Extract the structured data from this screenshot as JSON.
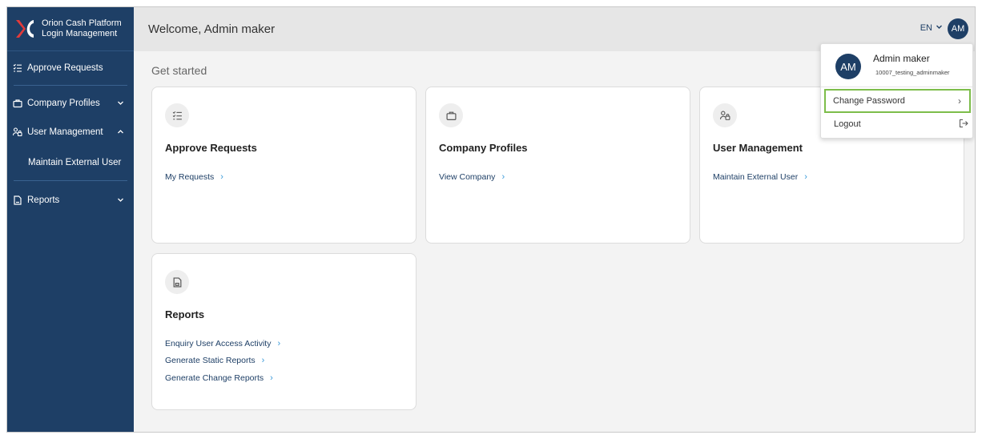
{
  "sidebar": {
    "brand_line1": "Orion Cash Platform",
    "brand_line2": "Login Management",
    "items": {
      "approve": "Approve Requests",
      "company": "Company Profiles",
      "users": "User Management",
      "maintain": "Maintain External User",
      "reports": "Reports"
    }
  },
  "header": {
    "welcome": "Welcome, Admin maker",
    "lang": "EN",
    "avatar": "AM"
  },
  "main": {
    "get_started": "Get started",
    "cards": [
      {
        "title": "Approve Requests",
        "links": [
          "My Requests"
        ]
      },
      {
        "title": "Company Profiles",
        "links": [
          "View Company"
        ]
      },
      {
        "title": "User Management",
        "links": [
          "Maintain External User"
        ]
      },
      {
        "title": "Reports",
        "links": [
          "Enquiry User Access Activity",
          "Generate Static Reports",
          "Generate Change Reports"
        ]
      }
    ]
  },
  "dropdown": {
    "avatar": "AM",
    "name": "Admin maker",
    "user_id": "10007_testing_adminmaker",
    "change_password": "Change Password",
    "logout": "Logout"
  },
  "colors": {
    "sidebar": "#1e3f66",
    "accent_link": "#3a9ad9",
    "highlight": "#7dbd4a"
  },
  "icons": {
    "card_approve": "checklist-icon",
    "card_company": "briefcase-icon",
    "card_users": "user-lock-icon",
    "card_reports": "document-icon",
    "logout": "logout-icon"
  }
}
